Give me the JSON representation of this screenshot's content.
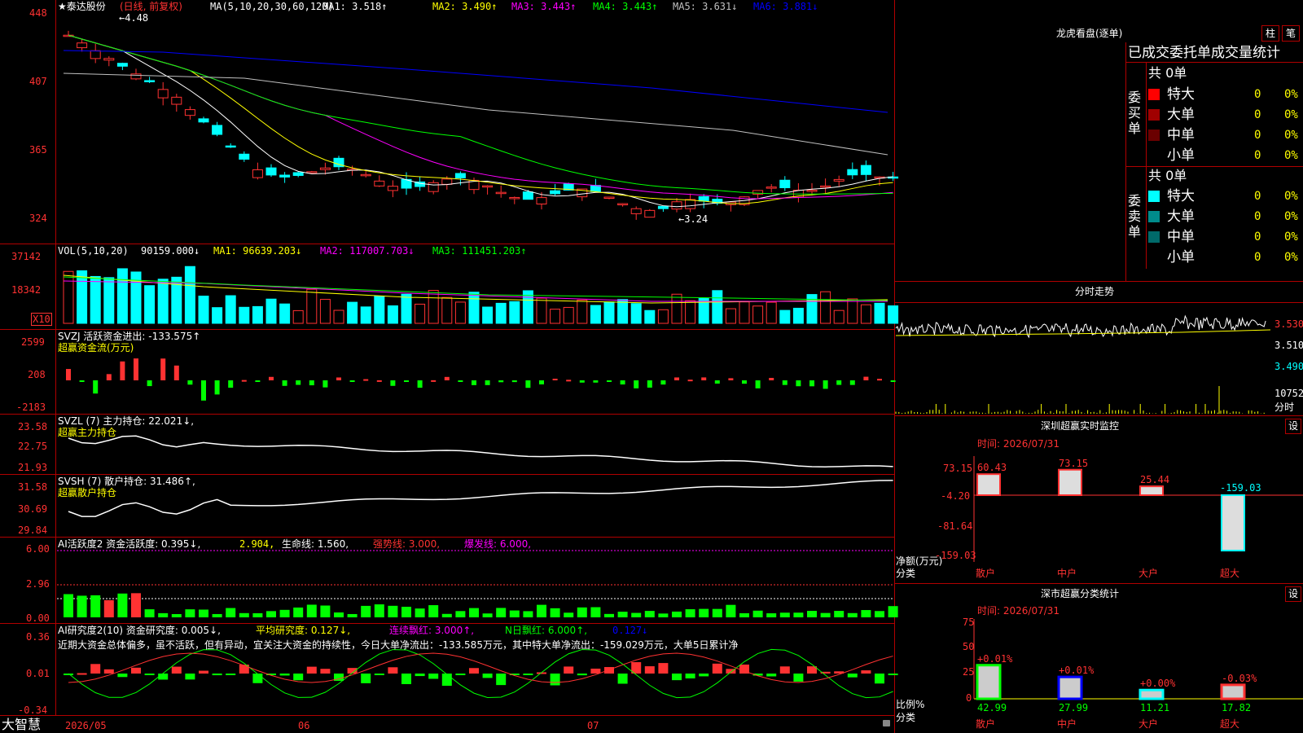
{
  "colors": {
    "up": "#ff3232",
    "down": "#00ffff",
    "ma1": "#ffffff",
    "ma2": "#ffff00",
    "ma3": "#ff00ff",
    "ma4": "#00ff00",
    "ma5": "#c0c0c0",
    "ma6": "#0000ff",
    "axis": "#ff3232",
    "frame": "#b00000",
    "green": "#00ff00",
    "yellow": "#ffff00",
    "magenta": "#ff00ff"
  },
  "price": {
    "stock": "★泰达股份",
    "period": "(日线, 前复权)",
    "ma_title": "MA(5,10,20,30,60,120)",
    "ma_values": [
      "MA1: 3.518↑",
      "MA2: 3.490↑",
      "MA3: 3.443↑",
      "MA4: 3.443↑",
      "MA5: 3.631↓",
      "MA6: 3.881↓"
    ],
    "yticks": [
      "448",
      "407",
      "365",
      "324"
    ],
    "high_mark": "4.48",
    "low_mark": "3.24"
  },
  "vol": {
    "title": "VOL(5,10,20)",
    "value": "90159.000↓",
    "ma1": "MA1: 96639.203↓",
    "ma2": "MA2: 117007.703↓",
    "ma3": "MA3: 111451.203↑",
    "yticks": [
      "37142",
      "18342"
    ],
    "unit": "X10"
  },
  "svzj": {
    "title": "SVZJ  活跃资金进出: -133.575↑",
    "sub": "超赢资金流(万元)",
    "yticks": [
      "2599",
      "208",
      "-2183"
    ]
  },
  "svzl": {
    "title": "SVZL (7) 主力持仓: 22.021↓,",
    "sub": "超赢主力持仓",
    "yticks": [
      "23.58",
      "22.75",
      "21.93"
    ]
  },
  "svsh": {
    "title": "SVSH (7) 散户持仓: 31.486↑,",
    "sub": "超赢散户持仓",
    "yticks": [
      "31.58",
      "30.69",
      "29.84"
    ]
  },
  "ai1": {
    "title": "AI活跃度2 资金活跃度: 0.395↓,",
    "v2": "2.904,",
    "life": "生命线: 1.560,",
    "strong": "强势线: 3.000,",
    "burst": "爆发线: 6.000,",
    "yticks": [
      "6.00",
      "2.96",
      "0.00"
    ]
  },
  "ai2": {
    "title": "AI研究度2(10) 资金研究度: 0.005↓,",
    "avg": "平均研究度: 0.127↓,",
    "cont": "连续飘红: 3.000↑,",
    "nday": "N日飘红: 6.000↑,",
    "last": "0.127↓",
    "text": "近期大资金总体偏多，虽不活跃，但有异动，宜关注大资金的持续性，今日大单净流出：-133.585万元，其中特大单净流出：-159.029万元，大单5日累计净",
    "yticks": [
      "0.36",
      "0.01",
      "-0.34"
    ]
  },
  "xaxis": {
    "labels": [
      "2026/05",
      "06",
      "07"
    ],
    "brand": "大智慧"
  },
  "dragon": {
    "title": "龙虎看盘(逐单)",
    "tabs": [
      "柱",
      "笔"
    ],
    "header": "已成交委托单成交量统计",
    "buy_label": "委买单",
    "sell_label": "委卖单",
    "buy_total": "共 0单",
    "sell_total": "共 0单",
    "buy_rows": [
      {
        "name": "特大",
        "n": "0",
        "p": "0%",
        "color": "#ff0000"
      },
      {
        "name": "大单",
        "n": "0",
        "p": "0%",
        "color": "#a00000"
      },
      {
        "name": "中单",
        "n": "0",
        "p": "0%",
        "color": "#6a0000"
      },
      {
        "name": "小单",
        "n": "0",
        "p": "0%",
        "color": "#000000"
      }
    ],
    "sell_rows": [
      {
        "name": "特大",
        "n": "0",
        "p": "0%",
        "color": "#00ffff"
      },
      {
        "name": "大单",
        "n": "0",
        "p": "0%",
        "color": "#008b8b"
      },
      {
        "name": "中单",
        "n": "0",
        "p": "0%",
        "color": "#006a6a"
      },
      {
        "name": "小单",
        "n": "0",
        "p": "0%",
        "color": "#000000"
      }
    ]
  },
  "intraday": {
    "title": "分时走势",
    "yticks": [
      "3.530",
      "3.510",
      "3.490"
    ],
    "vol": "10752",
    "vol_label": "分时"
  },
  "monitor": {
    "title": "深圳超赢实时监控",
    "set": "设",
    "time": "时间: 2026/07/31",
    "yticks": [
      "73.15",
      "-4.20",
      "-81.64",
      "-159.03"
    ],
    "ylabel": "净额(万元)",
    "xlabel": "分类",
    "bars": [
      {
        "label": "散户",
        "value": 60.43
      },
      {
        "label": "中户",
        "value": 73.15
      },
      {
        "label": "大户",
        "value": 25.44
      },
      {
        "label": "超大",
        "value": -159.03
      }
    ]
  },
  "classify": {
    "title": "深市超赢分类统计",
    "set": "设",
    "time": "时间: 2026/07/31",
    "yticks": [
      "75",
      "50",
      "25",
      "0"
    ],
    "ylabel": "比例%",
    "xlabel": "分类",
    "bars": [
      {
        "label": "散户",
        "value": 42.99,
        "delta": "+0.01%"
      },
      {
        "label": "中户",
        "value": 27.99,
        "delta": "+0.01%"
      },
      {
        "label": "大户",
        "value": 11.21,
        "delta": "+0.00%"
      },
      {
        "label": "超大",
        "value": 17.82,
        "delta": "-0.03%"
      }
    ]
  }
}
